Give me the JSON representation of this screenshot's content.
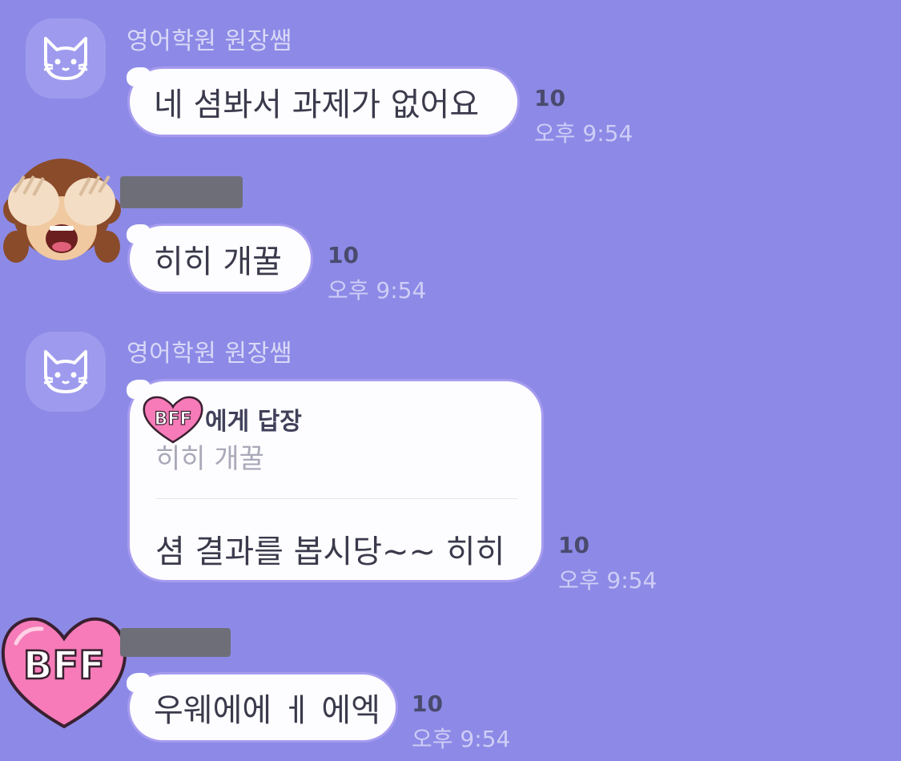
{
  "messages": [
    {
      "sender": "영어학원 원장쌤",
      "avatar": "cat-face-icon",
      "text": "네 셤봐서 과제가 없어요",
      "unread": "10",
      "time": "오후 9:54"
    },
    {
      "sender": "",
      "avatar": "monkey-see-no-evil-icon",
      "text": "히히 개꿀",
      "unread": "10",
      "time": "오후 9:54"
    },
    {
      "sender": "영어학원 원장쌤",
      "avatar": "cat-face-icon",
      "reply_to_label": "에게 답장",
      "reply_to_sticker_text": "BFF",
      "quoted_text": "히히 개꿀",
      "text": "셤 결과를 봅시당~~ 히히",
      "unread": "10",
      "time": "오후 9:54"
    },
    {
      "sender": "",
      "avatar": "bff-heart-icon",
      "avatar_text": "BFF",
      "text": "우웨에에 ㅔ 에엑",
      "unread": "10",
      "time": "오후 9:54"
    }
  ],
  "colors": {
    "background": "#8c8ae6",
    "bubble": "#fdfdff",
    "bubble_border": "#a69bef",
    "heart_pink": "#f67bb8"
  }
}
